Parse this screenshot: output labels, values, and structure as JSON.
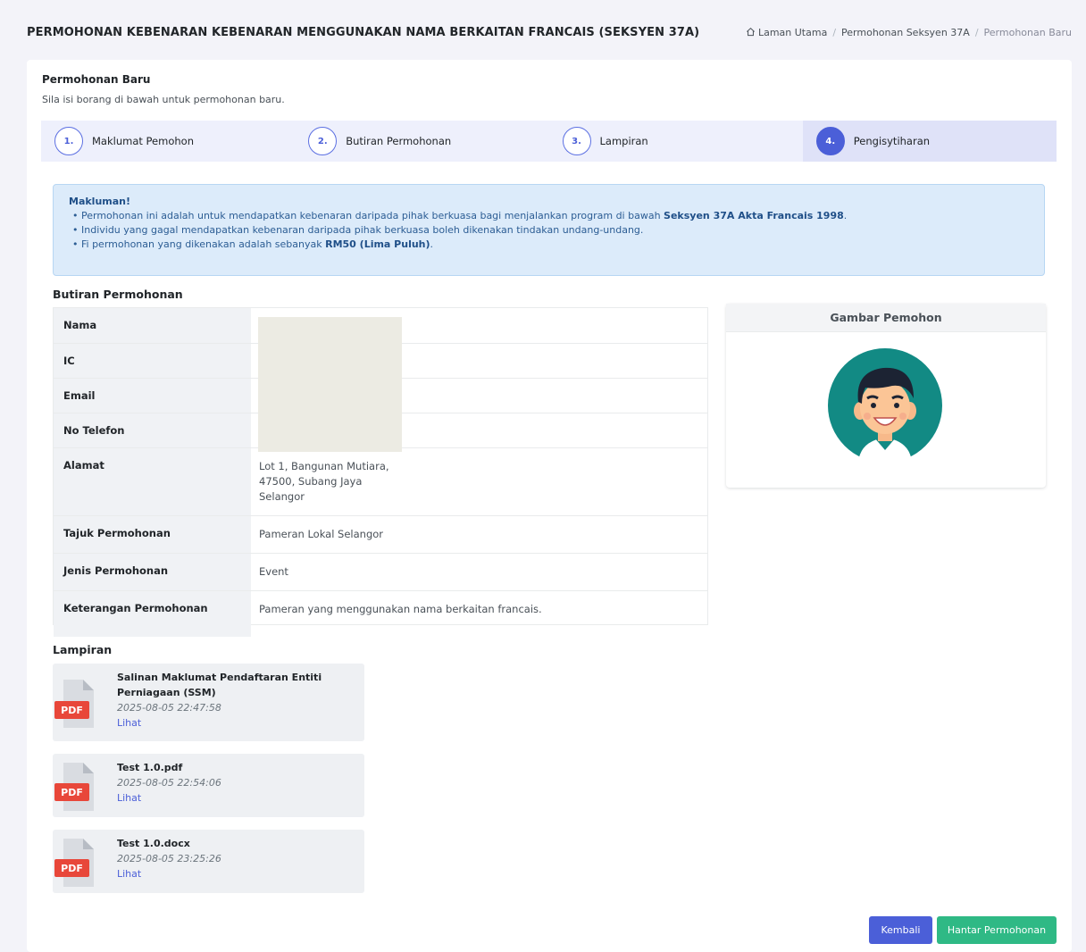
{
  "header": {
    "title": "PERMOHONAN KEBENARAN KEBENARAN MENGGUNAKAN NAMA BERKAITAN FRANCAIS (SEKSYEN 37A)",
    "breadcrumb": [
      "Laman Utama",
      "Permohonan Seksyen 37A",
      "Permohonan Baru"
    ]
  },
  "card": {
    "title": "Permohonan Baru",
    "subtitle": "Sila isi borang di bawah untuk permohonan baru."
  },
  "steps": [
    {
      "num": "1.",
      "label": "Maklumat Pemohon"
    },
    {
      "num": "2.",
      "label": "Butiran Permohonan"
    },
    {
      "num": "3.",
      "label": "Lampiran"
    },
    {
      "num": "4.",
      "label": "Pengisytiharan"
    }
  ],
  "active_step": 4,
  "alert": {
    "title": "Makluman!",
    "item1_text": "Permohonan ini adalah untuk mendapatkan kebenaran daripada pihak berkuasa bagi menjalankan program di bawah ",
    "item1_bold": "Seksyen 37A Akta Francais 1998",
    "item1_end": ".",
    "item2": "Individu yang gagal mendapatkan kebenaran daripada pihak berkuasa boleh dikenakan tindakan undang-undang.",
    "item3_text": "Fi permohonan yang dikenakan adalah sebanyak ",
    "item3_bold": "RM50 (Lima Puluh)",
    "item3_end": "."
  },
  "details": {
    "section_title": "Butiran Permohonan",
    "rows": [
      {
        "label": "Nama",
        "value": ""
      },
      {
        "label": "IC",
        "value": ""
      },
      {
        "label": "Email",
        "value": ""
      },
      {
        "label": "No Telefon",
        "value": ""
      },
      {
        "label": "Alamat",
        "line1": "Lot 1, Bangunan Mutiara,",
        "line2": "47500, Subang Jaya",
        "line3": "Selangor"
      },
      {
        "label": "Tajuk Permohonan",
        "value": "Pameran Lokal Selangor"
      },
      {
        "label": "Jenis Permohonan",
        "value": "Event"
      },
      {
        "label": "Keterangan Permohonan",
        "value": "Pameran yang menggunakan nama berkaitan francais."
      }
    ]
  },
  "photo": {
    "title": "Gambar Pemohon"
  },
  "attachments": {
    "section_title": "Lampiran",
    "icon_label": "PDF",
    "link_label": "Lihat",
    "items": [
      {
        "name": "Salinan Maklumat Pendaftaran Entiti Perniagaan (SSM)",
        "date": "2025-08-05 22:47:58"
      },
      {
        "name": "Test 1.0.pdf",
        "date": "2025-08-05 22:54:06"
      },
      {
        "name": "Test 1.0.docx",
        "date": "2025-08-05 23:25:26"
      }
    ]
  },
  "buttons": {
    "back": "Kembali",
    "submit": "Hantar Permohonan"
  },
  "colors": {
    "primary": "#4b5fd8",
    "success": "#2fb985",
    "alert_bg": "#dcebfa",
    "pdf_red": "#e8473a"
  }
}
